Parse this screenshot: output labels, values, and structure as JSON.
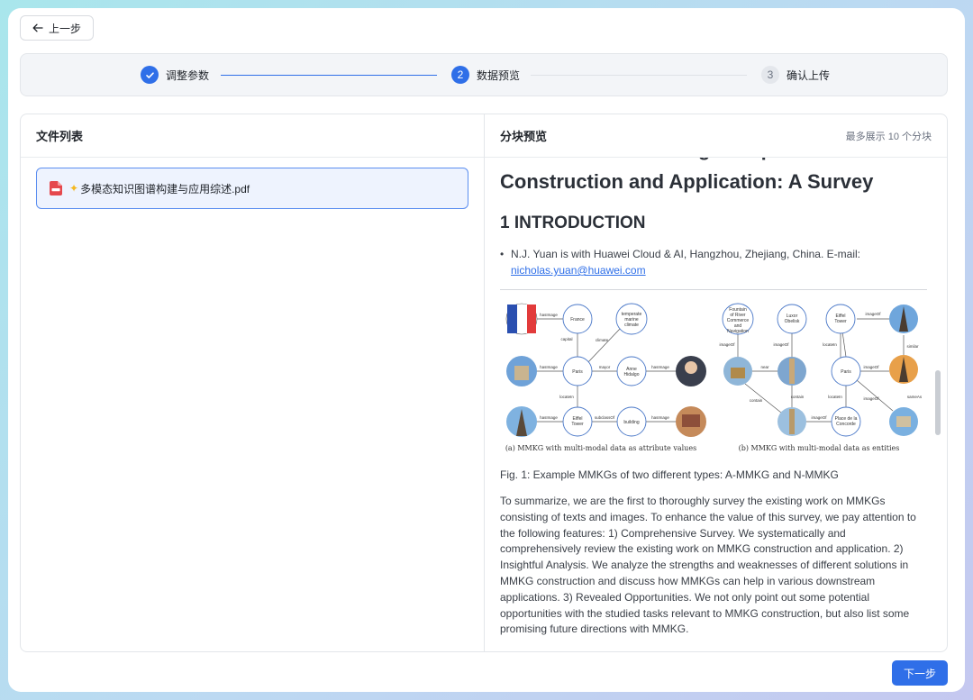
{
  "header": {
    "back_label": "上一步"
  },
  "stepper": {
    "steps": [
      {
        "number": "1",
        "label": "调整参数",
        "state": "done"
      },
      {
        "number": "2",
        "label": "数据预览",
        "state": "active"
      },
      {
        "number": "3",
        "label": "确认上传",
        "state": "todo"
      }
    ]
  },
  "file_list": {
    "title": "文件列表",
    "files": [
      {
        "name": "多模态知识图谱构建与应用综述.pdf",
        "icon": "pdf-icon"
      }
    ]
  },
  "chunk_preview": {
    "title": "分块预览",
    "hint": "最多展示 10 个分块",
    "doc_title_line1": "Multi-Modal Knowledge Graph",
    "doc_title_line2": "Construction and Application: A Survey",
    "section_heading": "1 INTRODUCTION",
    "bullet_text": "N.J. Yuan is with Huawei Cloud & AI, Hangzhou, Zhejiang, China. E-mail:",
    "bullet_email": "nicholas.yuan@huawei.com",
    "figure": {
      "caption_a": "(a) MMKG with multi-modal data as attribute values",
      "caption_b": "(b) MMKG with multi-modal data as entities",
      "nodes_a": [
        "France",
        "temperate marine climate",
        "Paris",
        "Anne Hidalgo",
        "Eiffel Tower",
        "building"
      ],
      "edges_a": [
        "hasImage",
        "capital",
        "climate",
        "hasImage",
        "mayor",
        "hasImage",
        "locateIn",
        "hasImage",
        "subclassOf",
        "hasImage"
      ],
      "nodes_b": [
        "Fountain of River Commerce and Navigation",
        "Luxor Obelisk",
        "Eiffel Tower",
        "Paris",
        "Place de la Concorde"
      ],
      "edges_b": [
        "imageOf",
        "imageOf",
        "imageOf",
        "locateIn",
        "similar",
        "near",
        "contain",
        "imageOf",
        "contain",
        "locateIn",
        "imageOf",
        "imageOf",
        "sameAs"
      ]
    },
    "caption": "Fig. 1: Example MMKGs of two different types: A-MMKG and N-MMKG",
    "paragraph": "To summarize, we are the first to thoroughly survey the existing work on MMKGs consisting of texts and images. To enhance the value of this survey, we pay attention to the following features: 1) Comprehensive Survey. We systematically and comprehensively review the existing work on MMKG construction and application. 2) Insightful Analysis. We analyze the strengths and weaknesses of different solutions in MMKG construction and discuss how MMKGs can help in various downstream applications. 3) Revealed Opportunities. We not only point out some potential opportunities with the studied tasks relevant to MMKG construction, but also list some promising future directions with MMKG."
  },
  "footer": {
    "next_label": "下一步"
  },
  "colors": {
    "primary": "#2f6fe8",
    "selected_bg": "#eef3fe",
    "border": "#e3e6ea"
  }
}
